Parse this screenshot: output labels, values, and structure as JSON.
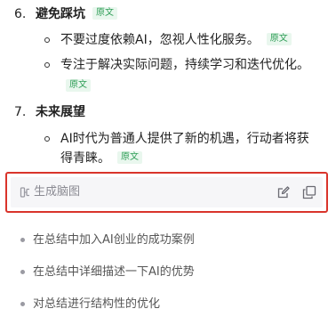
{
  "list": {
    "item6": {
      "number": "6.",
      "title": "避免踩坑",
      "badge": "原文",
      "subs": [
        {
          "text": "不要过度依赖AI，忽视人性化服务。",
          "badge": "原文"
        },
        {
          "text": "专注于解决实际问题，持续学习和迭代优化。",
          "badge": "原文"
        }
      ]
    },
    "item7": {
      "number": "7.",
      "title": "未来展望",
      "subs": [
        {
          "text": "AI时代为普通人提供了新的机遇，行动者将获得青睐。",
          "badge": "原文"
        }
      ]
    }
  },
  "mindmap": {
    "label": "生成脑图",
    "icon": "mindmap-icon",
    "edit_icon": "edit-icon",
    "copy_icon": "copy-icon"
  },
  "suggestions": [
    "在总结中加入AI创业的成功案例",
    "在总结中详细描述一下AI的优势",
    "对总结进行结构性的优化"
  ],
  "colors": {
    "badge_bg": "#e9f7ee",
    "badge_text": "#2f9e57",
    "highlight_border": "#d9342b"
  }
}
